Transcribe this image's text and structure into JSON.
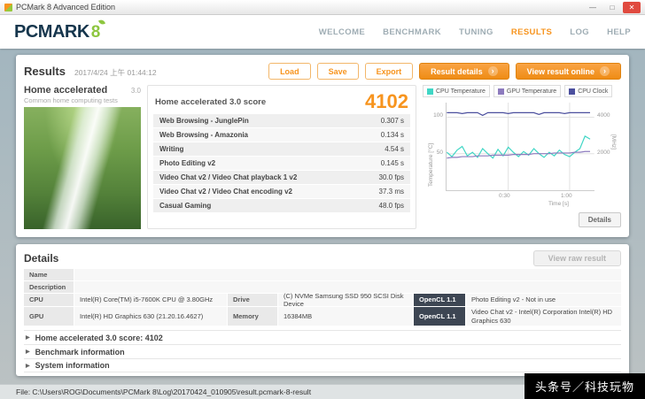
{
  "window": {
    "title": "PCMark 8 Advanced Edition",
    "controls": {
      "minimize": "—",
      "maximize": "□",
      "close": "✕"
    }
  },
  "nav": {
    "logo_text": "PCMARK",
    "logo_8": "8",
    "items": [
      {
        "label": "WELCOME"
      },
      {
        "label": "BENCHMARK"
      },
      {
        "label": "TUNING"
      },
      {
        "label": "RESULTS"
      },
      {
        "label": "LOG"
      },
      {
        "label": "HELP"
      }
    ],
    "active_item": "RESULTS",
    "accent_color": "#f7941e"
  },
  "results": {
    "title": "Results",
    "timestamp": "2017/4/24 上午 01:44:12",
    "buttons": {
      "load": "Load",
      "save": "Save",
      "export": "Export",
      "result_details": "Result details",
      "view_online": "View result online"
    },
    "test": {
      "name": "Home accelerated",
      "version": "3.0",
      "subtitle": "Common home computing tests"
    },
    "score_panel": {
      "title": "Home accelerated 3.0 score",
      "score": "4102",
      "rows": [
        {
          "label": "Web Browsing - JunglePin",
          "value": "0.307 s"
        },
        {
          "label": "Web Browsing - Amazonia",
          "value": "0.134 s"
        },
        {
          "label": "Writing",
          "value": "4.54 s"
        },
        {
          "label": "Photo Editing v2",
          "value": "0.145 s"
        },
        {
          "label": "Video Chat v2 / Video Chat playback 1 v2",
          "value": "30.0 fps"
        },
        {
          "label": "Video Chat v2 / Video Chat encoding v2",
          "value": "37.3 ms"
        },
        {
          "label": "Casual Gaming",
          "value": "48.0 fps"
        }
      ]
    },
    "monitor": {
      "details_button": "Details"
    }
  },
  "chart_data": {
    "type": "line",
    "x_label": "Time [s]",
    "x_ticks": [
      "0:30",
      "1:00"
    ],
    "x_tick_seconds": [
      30,
      60
    ],
    "x_max": 72,
    "y_left": {
      "label": "Temperature [°C]",
      "ticks": [
        50,
        100
      ],
      "max": 120
    },
    "y_right": {
      "label": "[MHz]",
      "ticks": [
        2000,
        4000
      ],
      "max": 4800
    },
    "x": [
      0,
      2.5,
      5,
      7.5,
      10,
      12.5,
      15,
      17.5,
      20,
      22.5,
      25,
      27.5,
      30,
      32.5,
      35,
      37.5,
      40,
      42.5,
      45,
      47.5,
      50,
      52.5,
      55,
      57.5,
      60,
      62.5,
      65,
      67.5,
      70
    ],
    "series": [
      {
        "name": "CPU Temperature",
        "color": "#3fd6c5",
        "axis": "left",
        "y": [
          52,
          46,
          55,
          60,
          47,
          52,
          45,
          57,
          50,
          44,
          56,
          47,
          59,
          52,
          46,
          53,
          48,
          57,
          50,
          45,
          52,
          47,
          55,
          49,
          46,
          52,
          57,
          74,
          70
        ]
      },
      {
        "name": "GPU Temperature",
        "color": "#8d7bbe",
        "axis": "left",
        "y": [
          44,
          45,
          45,
          46,
          46,
          46,
          47,
          47,
          47,
          48,
          48,
          48,
          48,
          49,
          49,
          49,
          49,
          50,
          50,
          50,
          50,
          51,
          51,
          51,
          51,
          52,
          52,
          53,
          53
        ]
      },
      {
        "name": "CPU Clock",
        "color": "#4b4f9e",
        "axis": "right",
        "y": [
          4250,
          4250,
          4250,
          4200,
          4250,
          4250,
          4250,
          4100,
          4250,
          4250,
          4250,
          4250,
          4200,
          4250,
          4250,
          4250,
          4250,
          4250,
          4150,
          4250,
          4250,
          4250,
          4250,
          4200,
          4250,
          4250,
          4250,
          4250,
          4250
        ]
      }
    ]
  },
  "details": {
    "title": "Details",
    "view_raw_button": "View raw result",
    "name_label": "Name",
    "description_label": "Description",
    "grid": [
      {
        "l1": "CPU",
        "v1": "Intel(R) Core(TM) i5-7600K CPU @ 3.80GHz",
        "l2": "Drive",
        "v2": "(C) NVMe Samsung SSD 950 SCSI Disk Device",
        "l3": "OpenCL 1.1",
        "v3": "Photo Editing v2 - Not in use"
      },
      {
        "l1": "GPU",
        "v1": "Intel(R) HD Graphics 630 (21.20.16.4627)",
        "l2": "Memory",
        "v2": "16384MB",
        "l3": "OpenCL 1.1",
        "v3": "Video Chat v2 - Intel(R) Corporation Intel(R) HD Graphics 630"
      }
    ],
    "expanders": [
      {
        "label": "Home accelerated 3.0 score: 4102"
      },
      {
        "label": "Benchmark information"
      },
      {
        "label": "System information"
      }
    ]
  },
  "statusbar": {
    "file": "File: C:\\Users\\ROG\\Documents\\PCMark 8\\Log\\20170424_010905\\result.pcmark-8-result"
  },
  "watermark": "头条号／科技玩物"
}
